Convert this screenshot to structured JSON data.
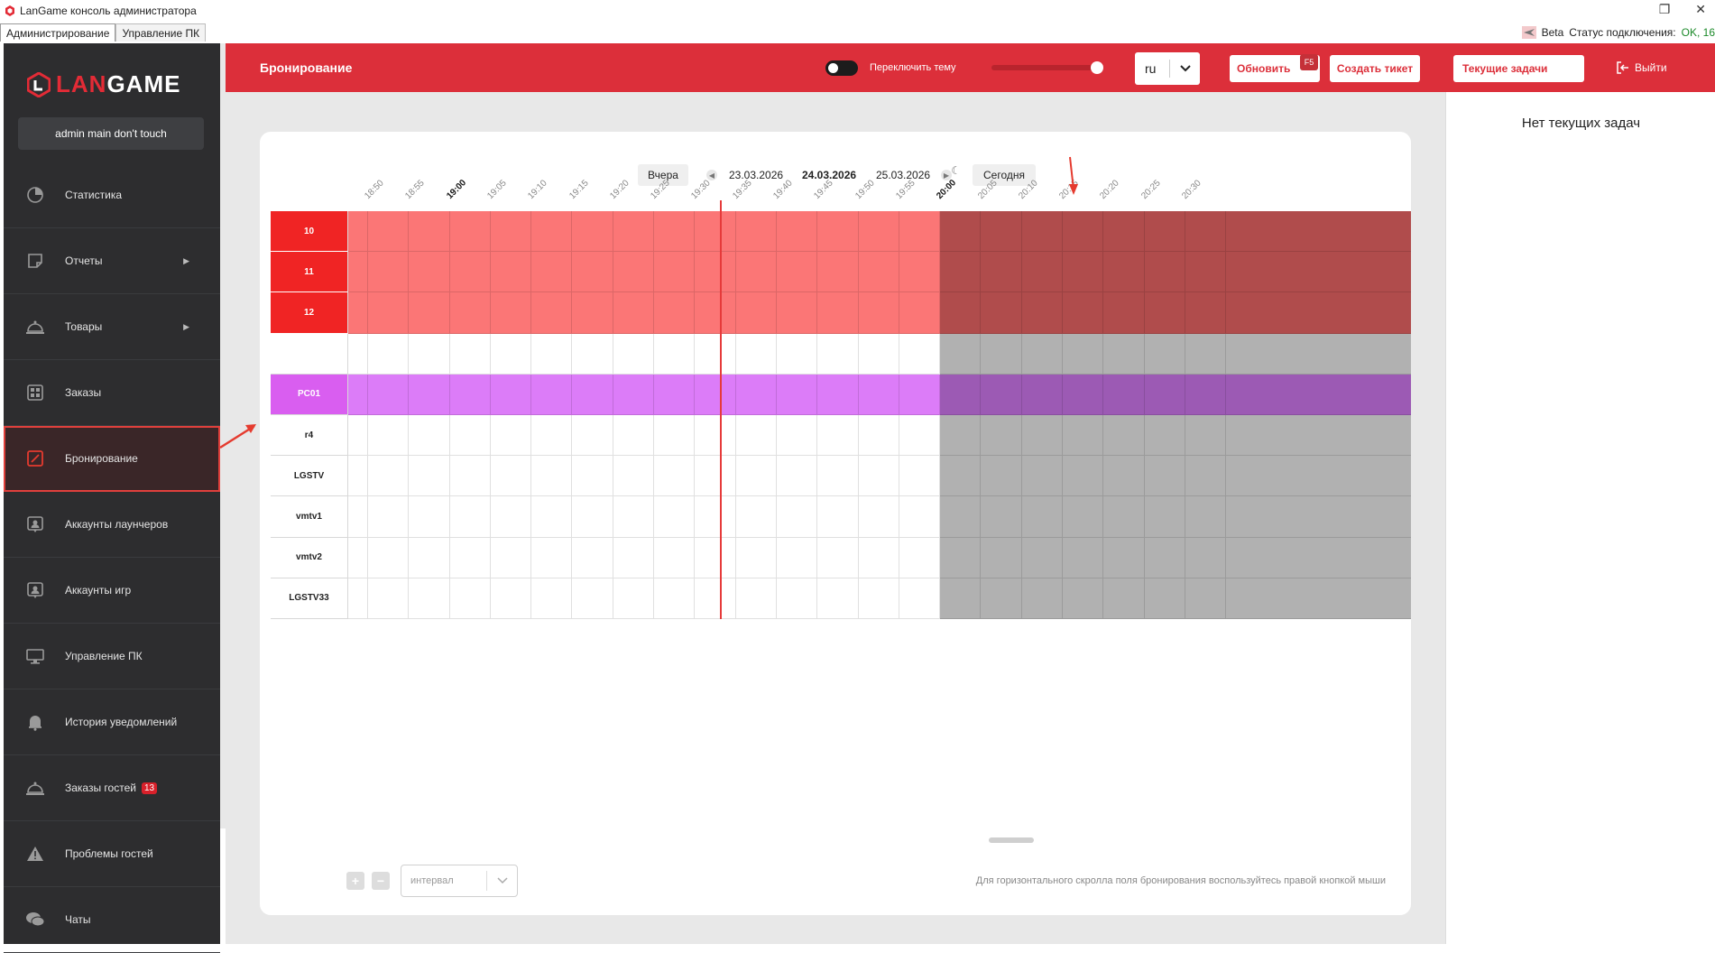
{
  "window": {
    "title": "LanGame консоль администратора",
    "restore_glyph": "❐",
    "close_glyph": "✕"
  },
  "app_tabs": [
    {
      "label": "Администрирование",
      "active": true
    },
    {
      "label": "Управление ПК",
      "active": false
    }
  ],
  "status": {
    "beta_label": "Beta",
    "connection_label": "Статус подключения:",
    "connection_value": "OK, 16"
  },
  "sidebar": {
    "logo_lan": "LAN",
    "logo_game": "GAME",
    "user": "admin main don't touch",
    "items": [
      {
        "label": "Статистика",
        "icon": "pie-chart-icon",
        "caret": false
      },
      {
        "label": "Отчеты",
        "icon": "note-icon",
        "caret": true
      },
      {
        "label": "Товары",
        "icon": "cloche-icon",
        "caret": true
      },
      {
        "label": "Заказы",
        "icon": "grid-icon",
        "caret": false
      },
      {
        "label": "Бронирование",
        "icon": "edit-square-icon",
        "caret": false,
        "active": true
      },
      {
        "label": "Аккаунты лаунчеров",
        "icon": "account-card-icon",
        "caret": false
      },
      {
        "label": "Аккаунты игр",
        "icon": "account-card-icon",
        "caret": false
      },
      {
        "label": "Управление ПК",
        "icon": "monitor-icon",
        "caret": false
      },
      {
        "label": "История уведомлений",
        "icon": "bell-icon",
        "caret": false
      },
      {
        "label": "Заказы гостей",
        "icon": "cloche-icon",
        "caret": false,
        "badge": "13"
      },
      {
        "label": "Проблемы гостей",
        "icon": "warning-icon",
        "caret": false
      },
      {
        "label": "Чаты",
        "icon": "chat-icon",
        "caret": false
      }
    ],
    "caret_glyph": "▶"
  },
  "header": {
    "title": "Бронирование",
    "theme_toggle_label": "Переключить тему",
    "language": "ru",
    "refresh_label": "Обновить",
    "refresh_hotkey": "F5",
    "create_ticket_label": "Создать тикет",
    "current_tasks_label": "Текущие задачи",
    "logout_label": "Выйти",
    "accent_color": "#dc2f3a"
  },
  "tasks_panel": {
    "empty_text": "Нет текущих задач"
  },
  "date_nav": {
    "yesterday_label": "Вчера",
    "prev_date": "23.03.2026",
    "current_date": "24.03.2026",
    "next_date": "25.03.2026",
    "today_label": "Сегодня",
    "prev_glyph": "◀",
    "next_glyph": "▶"
  },
  "timeline": {
    "times": [
      "18:50",
      "18:55",
      "19:00",
      "19:05",
      "19:10",
      "19:15",
      "19:20",
      "19:25",
      "19:30",
      "19:35",
      "19:40",
      "19:45",
      "19:50",
      "19:55",
      "20:00",
      "20:05",
      "20:10",
      "20:15",
      "20:20",
      "20:25",
      "20:30"
    ],
    "bold_times": [
      "19:00",
      "20:00"
    ],
    "now_time": "19:33",
    "night_from": "20:00",
    "moon_glyph": "☾"
  },
  "rows": [
    {
      "name": "10",
      "kind": "red"
    },
    {
      "name": "11",
      "kind": "red"
    },
    {
      "name": "12",
      "kind": "red"
    },
    {
      "name": "",
      "kind": "blank"
    },
    {
      "name": "PC01",
      "kind": "purple"
    },
    {
      "name": "r4",
      "kind": "blank"
    },
    {
      "name": "LGSTV",
      "kind": "blank"
    },
    {
      "name": "vmtv1",
      "kind": "blank"
    },
    {
      "name": "vmtv2",
      "kind": "blank"
    },
    {
      "name": "LGSTV33",
      "kind": "blank"
    }
  ],
  "row_colors": {
    "red_head": "#f02424",
    "red_day": "#fb7676",
    "red_night": "#b04c4c",
    "purple_head": "#d95ef0",
    "purple_day": "#dc7cf8",
    "purple_night": "#9c5ab4",
    "blank_day": "#ffffff",
    "blank_night": "#b1b1b1"
  },
  "footer": {
    "zoom_in": "+",
    "zoom_out": "−",
    "interval_placeholder": "интервал",
    "hint": "Для горизонтального скролла поля бронирования воспользуйтесь правой кнопкой мыши"
  }
}
